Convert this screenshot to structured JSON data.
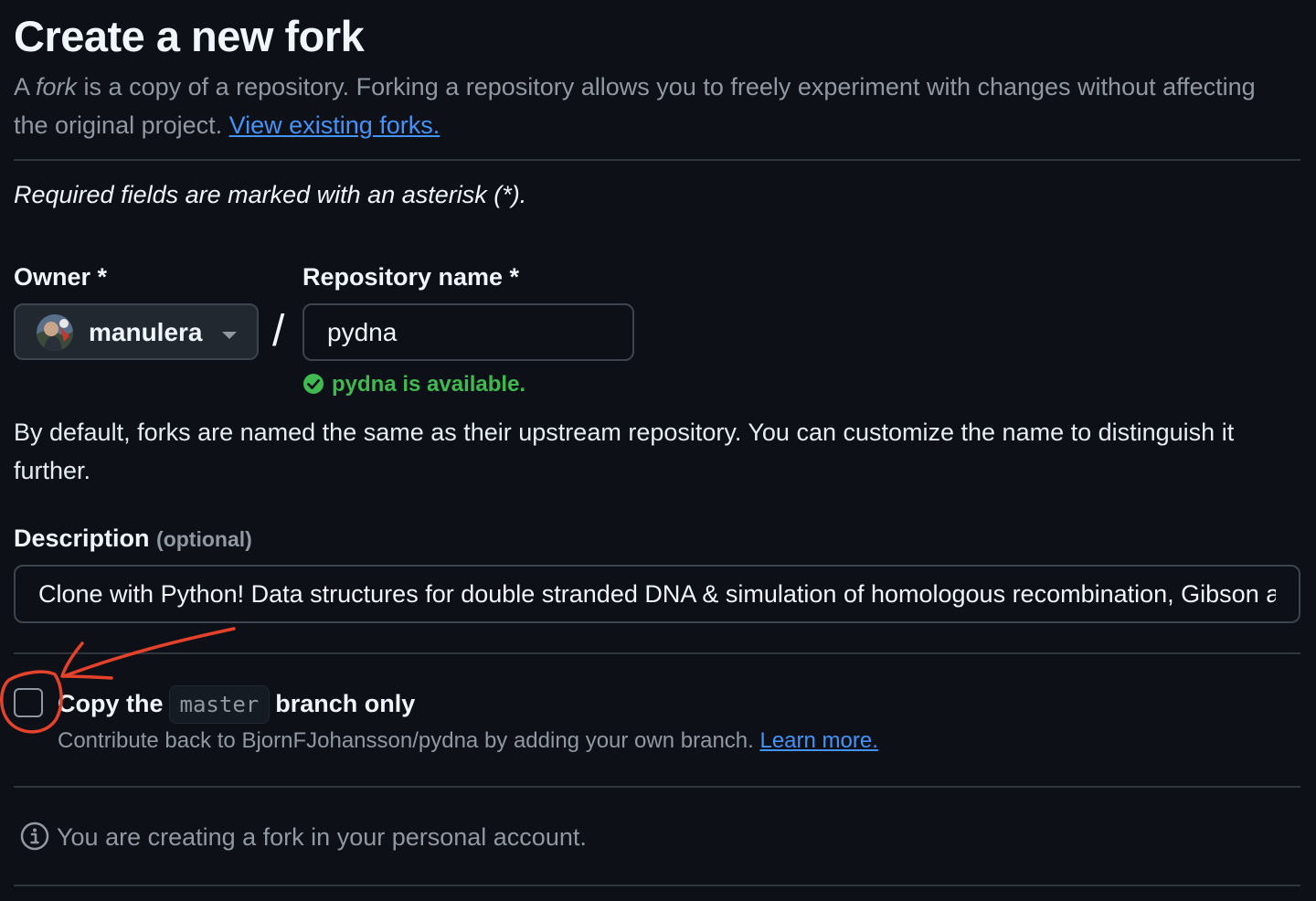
{
  "page": {
    "title": "Create a new fork",
    "intro_prefix": "A ",
    "intro_em": "fork",
    "intro_rest": " is a copy of a repository. Forking a repository allows you to freely experiment with changes without affecting the original project. ",
    "view_forks_link": "View existing forks.",
    "required_note": "Required fields are marked with an asterisk (*)."
  },
  "owner": {
    "label": "Owner *",
    "value": "manulera",
    "icon": "chevron-down-icon"
  },
  "separator": "/",
  "repository": {
    "label": "Repository name *",
    "value": "pydna",
    "availability": "pydna is available.",
    "availability_icon": "check-circle-icon",
    "availability_color": "#3fb950"
  },
  "help_text": "By default, forks are named the same as their upstream repository. You can customize the name to distinguish it further.",
  "description": {
    "label": "Description",
    "optional": "(optional)",
    "value": "Clone with Python! Data structures for double stranded DNA & simulation of homologous recombination, Gibson assembly, cut & paste cloning etc."
  },
  "copy_branch": {
    "label_prefix": "Copy the",
    "branch": "master",
    "label_suffix": "branch only",
    "checked": false,
    "sub_text": "Contribute back to BjornFJohansson/pydna by adding your own branch. ",
    "learn_more": "Learn more."
  },
  "info": {
    "icon": "info-icon",
    "text": "You are creating a fork in your personal account."
  },
  "colors": {
    "background": "#0d1117",
    "link": "#4493f8",
    "border": "#3d444d",
    "annotation": "#e5422b"
  }
}
